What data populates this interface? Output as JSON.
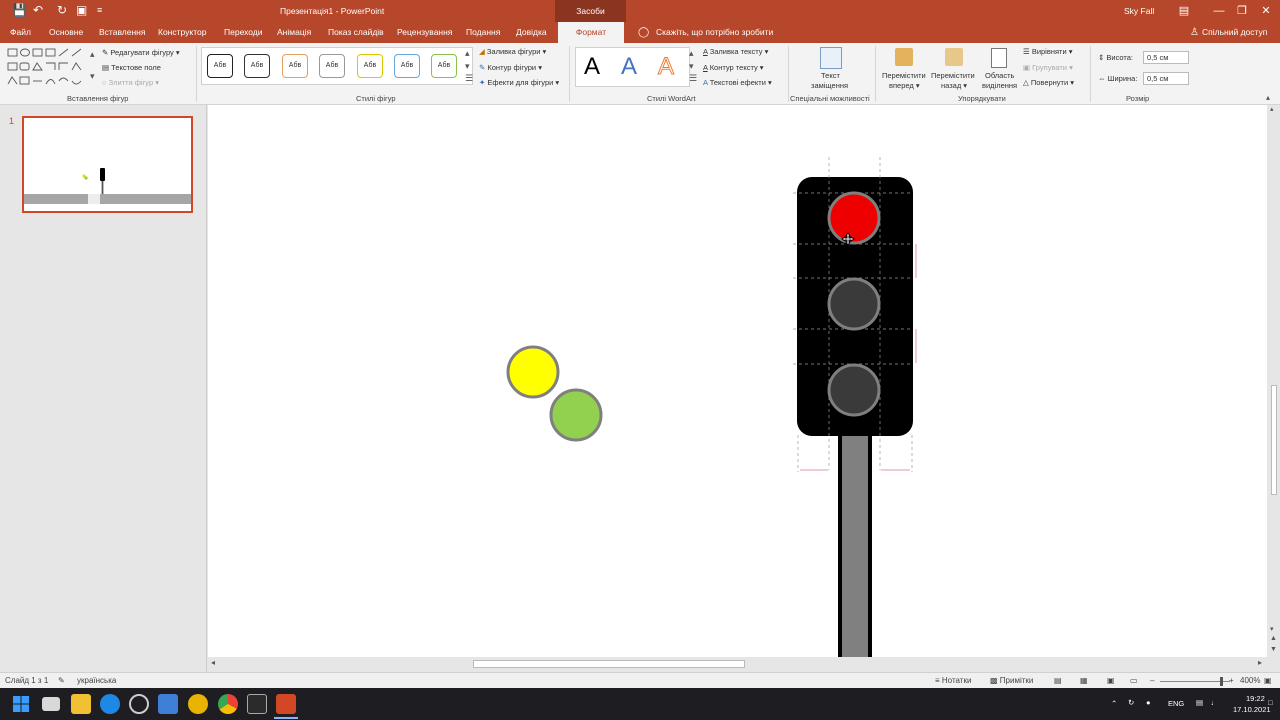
{
  "app": {
    "doc_title": "Презентація1 - PowerPoint",
    "context_group": "Засоби креслення",
    "user": "Sky Fall",
    "share": "Спільний доступ",
    "tell_me": "Скажіть, що потрібно зробити"
  },
  "tabs": [
    "Файл",
    "Основне",
    "Вставлення",
    "Конструктор",
    "Переходи",
    "Анімація",
    "Показ слайдів",
    "Рецензування",
    "Подання",
    "Довідка",
    "Формат"
  ],
  "ribbon": {
    "insert_shapes": {
      "label": "Вставлення фігур",
      "edit_shape": "Редагувати фігуру",
      "text_box": "Текстове поле",
      "merge_shapes": "Злиття фігур"
    },
    "shape_styles": {
      "label": "Стилі фігур",
      "sample": "Абв",
      "fill": "Заливка фігури",
      "outline": "Контур фігури",
      "effects": "Ефекти для фігури"
    },
    "wordart": {
      "label": "Стилі WordArt",
      "letter": "A",
      "text_fill": "Заливка тексту",
      "text_outline": "Контур тексту",
      "text_effects": "Текстові ефекти"
    },
    "accessibility": {
      "label": "Спеціальні можливості",
      "alt_text_1": "Текст",
      "alt_text_2": "заміщення"
    },
    "arrange": {
      "label": "Упорядкувати",
      "forward_1": "Перемістити",
      "forward_2": "вперед",
      "backward_1": "Перемістити",
      "backward_2": "назад",
      "pane_1": "Область",
      "pane_2": "виділення",
      "align": "Вирівняти",
      "group": "Групувати",
      "rotate": "Повернути"
    },
    "size": {
      "label": "Розмір",
      "height_label": "Висота:",
      "height_value": "0,5 см",
      "width_label": "Ширина:",
      "width_value": "0,5 см"
    }
  },
  "slides_pane": {
    "slide_number": "1"
  },
  "status": {
    "slide": "Слайд 1 з 1",
    "language": "українська",
    "notes": "Нотатки",
    "comments": "Примітки",
    "zoom": "400%"
  },
  "taskbar": {
    "lang": "ENG",
    "time": "19:22",
    "date": "17.10.2021"
  },
  "colors": {
    "accent": "#b7472a",
    "red_light": "#ee0000",
    "yellow_light": "#ffff00",
    "green_light": "#92d050",
    "off_light": "#3a3a3a"
  },
  "icons": [
    "save-icon",
    "undo-icon",
    "redo-icon",
    "search-icon",
    "windows-icon",
    "edge-icon",
    "chrome-icon",
    "powerpoint-icon"
  ]
}
